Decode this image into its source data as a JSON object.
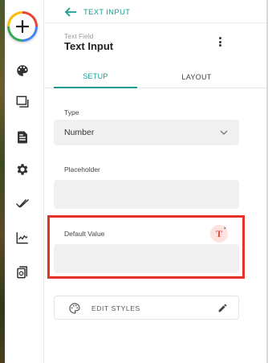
{
  "sidebar": {
    "add_icon": "plus-icon",
    "items": [
      {
        "name": "theme",
        "icon": "palette-icon"
      },
      {
        "name": "pages",
        "icon": "layers-icon"
      },
      {
        "name": "data",
        "icon": "document-icon"
      },
      {
        "name": "settings",
        "icon": "gear-icon"
      },
      {
        "name": "actions",
        "icon": "double-check-icon"
      },
      {
        "name": "analytics",
        "icon": "chart-icon"
      },
      {
        "name": "publish",
        "icon": "publish-icon"
      }
    ]
  },
  "header": {
    "back_label": "TEXT INPUT",
    "breadcrumb": "Text Field",
    "title": "Text Input"
  },
  "tabs": [
    {
      "label": "SETUP",
      "active": true
    },
    {
      "label": "LAYOUT",
      "active": false
    }
  ],
  "fields": {
    "type": {
      "label": "Type",
      "value": "Number"
    },
    "placeholder": {
      "label": "Placeholder",
      "value": ""
    },
    "default_value": {
      "label": "Default Value",
      "value": ""
    }
  },
  "edit_styles_label": "EDIT STYLES",
  "colors": {
    "accent": "#1a9c8f",
    "highlight": "#e53222",
    "field_bg": "#f0f0f0"
  }
}
